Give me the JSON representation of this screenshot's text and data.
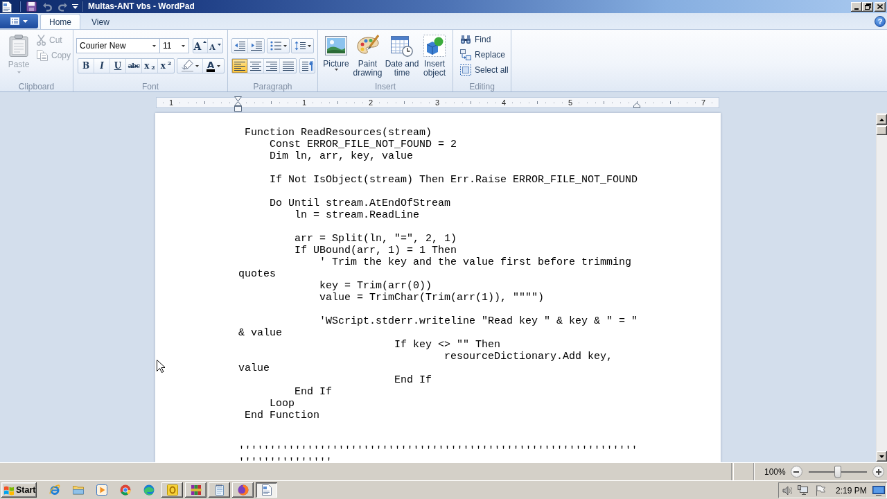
{
  "window": {
    "title": "Multas-ANT vbs - WordPad"
  },
  "tabs": [
    {
      "label": "Home",
      "selected": true
    },
    {
      "label": "View",
      "selected": false
    }
  ],
  "help": {
    "glyph": "?"
  },
  "ribbon": {
    "groups": [
      {
        "kind": "clipboard",
        "label": "Clipboard",
        "paste": {
          "label": "Paste",
          "disabled": true
        },
        "actions": [
          {
            "kind": "cut",
            "label": "Cut",
            "disabled": true
          },
          {
            "kind": "copy",
            "label": "Copy",
            "disabled": true
          }
        ]
      },
      {
        "kind": "font",
        "label": "Font",
        "font_name": "Courier New",
        "font_size": "11",
        "size_buttons": [
          {
            "kind": "grow",
            "glyph": "A"
          },
          {
            "kind": "shrink",
            "glyph": "A"
          }
        ],
        "styles": [
          {
            "kind": "bold",
            "label": "B"
          },
          {
            "kind": "italic",
            "label": "I"
          },
          {
            "kind": "underline",
            "label": "U"
          },
          {
            "kind": "strikethrough",
            "label": "abc"
          },
          {
            "kind": "subscript",
            "label": "x$_{2}$"
          },
          {
            "kind": "superscript",
            "label": "x$^{2}$"
          }
        ],
        "text_color": {
          "glyph": "A"
        }
      },
      {
        "kind": "paragraph",
        "label": "Paragraph",
        "alignments": [
          {
            "kind": "left",
            "selected": true
          },
          {
            "kind": "center",
            "selected": false
          },
          {
            "kind": "right",
            "selected": false
          },
          {
            "kind": "justify",
            "selected": false
          }
        ]
      },
      {
        "kind": "insert",
        "label": "Insert",
        "buttons": [
          {
            "kind": "picture",
            "label": "Picture",
            "dropdown": true
          },
          {
            "kind": "paint",
            "label": "Paint drawing",
            "dropdown": false
          },
          {
            "kind": "datetime",
            "label": "Date and time",
            "dropdown": false
          },
          {
            "kind": "object",
            "label": "Insert object",
            "dropdown": false
          }
        ]
      },
      {
        "kind": "editing",
        "label": "Editing",
        "actions": [
          {
            "kind": "find",
            "label": "Find"
          },
          {
            "kind": "replace",
            "label": "Replace"
          },
          {
            "kind": "select_all",
            "label": "Select all"
          }
        ]
      }
    ]
  },
  "ruler": {
    "marks": [
      {
        "kind": "number",
        "label": "1"
      },
      {
        "kind": "left_indent"
      },
      {
        "kind": "number",
        "label": "1"
      },
      {
        "kind": "number",
        "label": "2"
      },
      {
        "kind": "number",
        "label": "3"
      },
      {
        "kind": "number",
        "label": "4"
      },
      {
        "kind": "number",
        "label": "5"
      },
      {
        "kind": "right_indent"
      },
      {
        "kind": "number",
        "label": "7"
      }
    ]
  },
  "document": {
    "lines": [
      {
        "kind": "code",
        "text": " Function ReadResources(stream)"
      },
      {
        "kind": "code",
        "text": "     Const ERROR_FILE_NOT_FOUND = 2"
      },
      {
        "kind": "code",
        "text": "     Dim ln, arr, key, value"
      },
      {
        "kind": "blank"
      },
      {
        "kind": "code",
        "text": "     If Not IsObject(stream) Then Err.Raise ERROR_FILE_NOT_FOUND"
      },
      {
        "kind": "blank"
      },
      {
        "kind": "code",
        "text": "     Do Until stream.AtEndOfStream"
      },
      {
        "kind": "code",
        "text": "         ln = stream.ReadLine"
      },
      {
        "kind": "blank"
      },
      {
        "kind": "code",
        "text": "         arr = Split(ln, \"=\", 2, 1)"
      },
      {
        "kind": "code",
        "text": "         If UBound(arr, 1) = 1 Then"
      },
      {
        "kind": "code",
        "text": "             ' Trim the key and the value first before trimming"
      },
      {
        "kind": "code",
        "text": "quotes"
      },
      {
        "kind": "code",
        "text": "             key = Trim(arr(0))"
      },
      {
        "kind": "code",
        "text": "             value = TrimChar(Trim(arr(1)), \"\"\"\")"
      },
      {
        "kind": "blank"
      },
      {
        "kind": "code",
        "text": "             'WScript.stderr.writeline \"Read key \" & key & \" = \""
      },
      {
        "kind": "code",
        "text": "& value"
      },
      {
        "kind": "code",
        "text": "                         If key <> \"\" Then"
      },
      {
        "kind": "code",
        "text": "                                 resourceDictionary.Add key,"
      },
      {
        "kind": "code",
        "text": "value"
      },
      {
        "kind": "code",
        "text": "                         End If"
      },
      {
        "kind": "code",
        "text": "         End If"
      },
      {
        "kind": "code",
        "text": "     Loop"
      },
      {
        "kind": "code",
        "text": " End Function"
      },
      {
        "kind": "blank"
      },
      {
        "kind": "blank"
      },
      {
        "kind": "code",
        "text": "''''''''''''''''''''''''''''''''''''''''''''''''''''''''''''''''"
      },
      {
        "kind": "code",
        "text": "'''''''''''''''"
      }
    ]
  },
  "status_bar": {
    "zoom": "100%",
    "zoom_slider": {
      "level": 0.5
    }
  },
  "taskbar": {
    "start": "Start",
    "quick_launch": [
      {
        "kind": "ie"
      },
      {
        "kind": "folder"
      },
      {
        "kind": "media"
      },
      {
        "kind": "chrome"
      },
      {
        "kind": "edge"
      }
    ],
    "tasks": [
      {
        "kind": "outlook",
        "selected": false
      },
      {
        "kind": "winrar",
        "selected": false
      },
      {
        "kind": "notepad",
        "selected": false
      },
      {
        "kind": "firefox",
        "selected": false
      },
      {
        "kind": "wordpad",
        "selected": true
      }
    ],
    "clock": "2:19 PM"
  }
}
